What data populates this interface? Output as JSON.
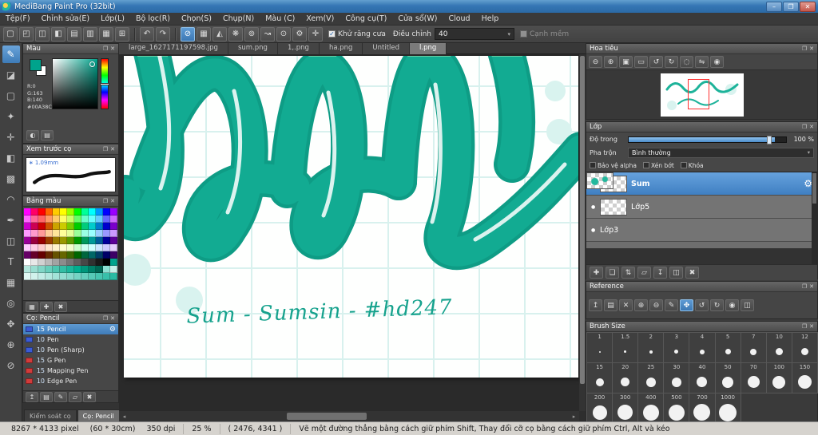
{
  "ui": {
    "accent_blue": "#4a8fd6",
    "current_color": "#00A38C",
    "icons": {
      "float": "❐",
      "close": "✕",
      "gear": "⚙",
      "chevron": "▾",
      "dot": "●",
      "left": "◂",
      "right": "▸",
      "star": "∗"
    }
  },
  "titlebar": {
    "title": "MediBang Paint Pro (32bit)",
    "buttons": [
      {
        "name": "minimize-button",
        "glyph": "–"
      },
      {
        "name": "maximize-button",
        "glyph": "❐"
      },
      {
        "name": "close-button",
        "glyph": "✕"
      }
    ]
  },
  "menubar": {
    "items": [
      "Tệp(F)",
      "Chỉnh sửa(E)",
      "Lớp(L)",
      "Bộ lọc(R)",
      "Chọn(S)",
      "Chụp(N)",
      "Màu (C)",
      "Xem(V)",
      "Công cụ(T)",
      "Cửa sổ(W)",
      "Cloud",
      "Help"
    ]
  },
  "toolbar": {
    "file_icons": [
      {
        "name": "new-canvas-icon",
        "glyph": "▢"
      },
      {
        "name": "open-file-icon",
        "glyph": "◰"
      },
      {
        "name": "save-icon",
        "glyph": "◫"
      },
      {
        "name": "export-icon",
        "glyph": "◧"
      },
      {
        "name": "copy-icon",
        "glyph": "▤"
      },
      {
        "name": "paste-icon",
        "glyph": "▥"
      },
      {
        "name": "material-panel-icon",
        "glyph": "▦"
      },
      {
        "name": "grid-view-icon",
        "glyph": "⊞"
      }
    ],
    "undo_icons": [
      {
        "name": "undo-icon",
        "glyph": "↶"
      },
      {
        "name": "redo-icon",
        "glyph": "↷"
      }
    ],
    "snap_icons": [
      {
        "name": "snap-off-icon",
        "glyph": "⊘",
        "selected": true
      },
      {
        "name": "snap-parallel-icon",
        "glyph": "▦"
      },
      {
        "name": "snap-crisscross-icon",
        "glyph": "◭"
      },
      {
        "name": "snap-vanishing-icon",
        "glyph": "❋"
      },
      {
        "name": "snap-concentric-icon",
        "glyph": "⊚"
      },
      {
        "name": "snap-curve-icon",
        "glyph": "↝"
      },
      {
        "name": "snap-focus-icon",
        "glyph": "⊙"
      },
      {
        "name": "snap-gear-icon",
        "glyph": "⚙"
      },
      {
        "name": "snap-target-icon",
        "glyph": "✛"
      }
    ],
    "antialias_label": "Khử răng cưa",
    "adjust_label": "Điều chỉnh",
    "adjust_value": "40",
    "soft_edge_label": "Cạnh mềm"
  },
  "toolstrip": {
    "tools": [
      {
        "name": "brush-tool",
        "glyph": "✎",
        "selected": true
      },
      {
        "name": "eraser-tool",
        "glyph": "◪"
      },
      {
        "name": "select-tool",
        "glyph": "▢"
      },
      {
        "name": "magic-wand-tool",
        "glyph": "✦"
      },
      {
        "name": "move-tool",
        "glyph": "✛"
      },
      {
        "name": "fill-tool",
        "glyph": "◧"
      },
      {
        "name": "gradient-tool",
        "glyph": "▩"
      },
      {
        "name": "lasso-tool",
        "glyph": "◠"
      },
      {
        "name": "select-pen-tool",
        "glyph": "✒"
      },
      {
        "name": "select-eraser-tool",
        "glyph": "◫"
      },
      {
        "name": "text-tool",
        "glyph": "T"
      },
      {
        "name": "frame-divide-tool",
        "glyph": "▦"
      },
      {
        "name": "eyedropper-tool",
        "glyph": "◎"
      },
      {
        "name": "hand-tool",
        "glyph": "✥"
      },
      {
        "name": "zoom-tool",
        "glyph": "⊕"
      },
      {
        "name": "snap-tool",
        "glyph": "⊘"
      }
    ]
  },
  "color_panel": {
    "title": "Màu",
    "r": "R:0",
    "g": "G:163",
    "b": "B:140",
    "hex": "#00A38C",
    "buttons": [
      {
        "name": "color-wheel-icon",
        "glyph": "◐"
      },
      {
        "name": "color-slider-icon",
        "glyph": "▤"
      }
    ]
  },
  "brush_preview_panel": {
    "title": "Xem trước cọ",
    "size": "1.09mm"
  },
  "palette_panel": {
    "title": "Bảng màu",
    "buttons": [
      {
        "name": "palette-grid-icon",
        "glyph": "▦"
      },
      {
        "name": "palette-add-icon",
        "glyph": "✚"
      },
      {
        "name": "palette-delete-icon",
        "glyph": "✖"
      }
    ],
    "colors": [
      "#FF00FF",
      "#FF0066",
      "#FF0000",
      "#FF6600",
      "#FFCC00",
      "#FFFF00",
      "#99FF00",
      "#00FF00",
      "#00FF99",
      "#00FFFF",
      "#0099FF",
      "#0000FF",
      "#9900FF",
      "#FF66FF",
      "#FF6699",
      "#FF6666",
      "#FF9966",
      "#FFCC66",
      "#FFFF66",
      "#CCFF66",
      "#66FF66",
      "#66FFCC",
      "#66FFFF",
      "#66CCFF",
      "#6666FF",
      "#CC66FF",
      "#CC00CC",
      "#CC0052",
      "#CC0000",
      "#CC5200",
      "#CCA300",
      "#CCCC00",
      "#7ACC00",
      "#00CC00",
      "#00CC7A",
      "#00CCCC",
      "#007ACC",
      "#0000CC",
      "#7A00CC",
      "#FF99FF",
      "#FF99CC",
      "#FF9999",
      "#FFCC99",
      "#FFE599",
      "#FFFF99",
      "#E5FF99",
      "#99FF99",
      "#99FFE5",
      "#99FFFF",
      "#99CCFF",
      "#9999FF",
      "#CC99FF",
      "#990099",
      "#99003D",
      "#990000",
      "#993D00",
      "#997A00",
      "#999900",
      "#5C9900",
      "#009900",
      "#00995C",
      "#009999",
      "#005C99",
      "#000099",
      "#5C0099",
      "#FFCCFF",
      "#FFCCE5",
      "#FFCCCC",
      "#FFE5CC",
      "#FFF2CC",
      "#FFFFCC",
      "#F2FFCC",
      "#CCFFCC",
      "#CCFFF2",
      "#CCFFFF",
      "#CCE5FF",
      "#CCCCFF",
      "#E5CCFF",
      "#660066",
      "#660029",
      "#660000",
      "#662900",
      "#665200",
      "#666600",
      "#3D6600",
      "#006600",
      "#00663D",
      "#006666",
      "#003D66",
      "#000066",
      "#3D0066",
      "#FFFFFF",
      "#E8E8E8",
      "#D1D1D1",
      "#BABABA",
      "#A3A3A3",
      "#8C8C8C",
      "#757575",
      "#5E5E5E",
      "#474747",
      "#303030",
      "#191919",
      "#000000",
      "#00A38C",
      "#B3E6DC",
      "#99DED1",
      "#80D6C6",
      "#66CEBB",
      "#4DC6B0",
      "#33BEA5",
      "#1AB69A",
      "#00AE8F",
      "#00967B",
      "#007E67",
      "#006653",
      "#8CE0D2",
      "#C6F0E9",
      "#E0F7F3",
      "#D1F2EC",
      "#C2EDE6",
      "#B3E8DF",
      "#A3E3D8",
      "#94DED2",
      "#85D9CB",
      "#75D4C4",
      "#66CFBE",
      "#57CAB7",
      "#47C5B0",
      "#38C0AA",
      "#29BBA3"
    ]
  },
  "brush_list_panel": {
    "title": "Cọ: Pencil",
    "brushes": [
      {
        "size": "15",
        "name": "Pencil",
        "selected": true,
        "tag": "#3b5bd6"
      },
      {
        "size": "10",
        "name": "Pen",
        "tag": "#3b5bd6"
      },
      {
        "size": "10",
        "name": "Pen (Sharp)",
        "tag": "#3b5bd6"
      },
      {
        "size": "15",
        "name": "G Pen",
        "tag": "#d23b3b"
      },
      {
        "size": "15",
        "name": "Mapping Pen",
        "tag": "#d23b3b"
      },
      {
        "size": "10",
        "name": "Edge Pen",
        "tag": "#d23b3b"
      }
    ],
    "buttons": [
      {
        "name": "brush-upload-icon",
        "glyph": "↥"
      },
      {
        "name": "brush-menu-icon",
        "glyph": "▤"
      },
      {
        "name": "brush-add-icon",
        "gly_x": "",
        "glyph": "✎"
      },
      {
        "name": "brush-folder-icon",
        "glyph": "▱"
      },
      {
        "name": "brush-delete-icon",
        "glyph": "✖"
      }
    ]
  },
  "dock_tabs": [
    {
      "label": "Kiểm soát cọ"
    },
    {
      "label": "Cọ: Pencil",
      "active": true
    }
  ],
  "canvas": {
    "tabs": [
      {
        "label": "large_1627171197598.jpg"
      },
      {
        "label": "sum.png"
      },
      {
        "label": "1,.png"
      },
      {
        "label": "ha.png"
      },
      {
        "label": "Untitled"
      },
      {
        "label": "l.png",
        "active": true
      }
    ],
    "caption": "Sum - Sumsin - #hd247"
  },
  "navigator_panel": {
    "title": "Hoa tiêu",
    "buttons": [
      {
        "name": "nav-zoom-out-icon",
        "glyph": "⊖"
      },
      {
        "name": "nav-zoom-in-icon",
        "glyph": "⊕"
      },
      {
        "name": "nav-fit-icon",
        "glyph": "▣"
      },
      {
        "name": "nav-actual-size-icon",
        "glyph": "▭"
      },
      {
        "name": "nav-rotate-left-icon",
        "glyph": "↺"
      },
      {
        "name": "nav-rotate-right-icon",
        "glyph": "↻"
      },
      {
        "name": "nav-reset-rotation-icon",
        "glyph": "◌"
      },
      {
        "name": "nav-flip-icon",
        "glyph": "⇋"
      },
      {
        "name": "nav-refresh-icon",
        "glyph": "◉"
      }
    ]
  },
  "layers_panel": {
    "title": "Lớp",
    "opacity_label": "Độ trong",
    "opacity_value": "100 %",
    "blend_label": "Pha trộn",
    "blend_mode": "Bình thường",
    "options": [
      "Bảo vệ alpha",
      "Xén bớt",
      "Khóa"
    ],
    "layers": [
      {
        "name": "Sum",
        "selected": true
      },
      {
        "name": "Lớp5"
      },
      {
        "name": "Lớp3",
        "art": true
      }
    ],
    "buttons": [
      {
        "name": "add-layer-button",
        "glyph": "✚"
      },
      {
        "name": "duplicate-layer-button",
        "glyph": "❏"
      },
      {
        "name": "move-layer-button",
        "glyph": "⇅"
      },
      {
        "name": "layer-folder-button",
        "glyph": "▱"
      },
      {
        "name": "merge-layer-button",
        "glyph": "↧"
      },
      {
        "name": "clear-layer-button",
        "glyph": "◫"
      },
      {
        "name": "delete-layer-button",
        "glyph": "✖"
      }
    ]
  },
  "reference_panel": {
    "title": "Reference",
    "buttons": [
      {
        "name": "ref-import-icon",
        "glyph": "↥"
      },
      {
        "name": "ref-open-icon",
        "glyph": "▤"
      },
      {
        "name": "ref-clear-icon",
        "glyph": "✕"
      },
      {
        "name": "ref-zoom-in-icon",
        "glyph": "⊕"
      },
      {
        "name": "ref-zoom-out-icon",
        "glyph": "⊖"
      },
      {
        "name": "ref-eyedropper-icon",
        "glyph": "✎"
      },
      {
        "name": "ref-hand-icon",
        "glyph": "✥",
        "selected": true
      },
      {
        "name": "ref-rotate-left-icon",
        "glyph": "↺"
      },
      {
        "name": "ref-rotate-right-icon",
        "glyph": "↻"
      },
      {
        "name": "ref-reset-icon",
        "glyph": "◉"
      },
      {
        "name": "ref-flip-icon",
        "glyph": "◫"
      }
    ]
  },
  "brush_size_panel": {
    "title": "Brush Size",
    "sizes": [
      "1",
      "1.5",
      "2",
      "3",
      "4",
      "5",
      "7",
      "10",
      "12",
      "15",
      "20",
      "25",
      "30",
      "40",
      "50",
      "70",
      "100",
      "150",
      "200",
      "300",
      "400",
      "500",
      "700",
      "1000"
    ]
  },
  "statusbar": {
    "pixel_size": "8267 * 4133 pixel",
    "cm_size": "(60 * 30cm)",
    "dpi": "350 dpi",
    "zoom": "25 %",
    "cursor": "( 2476, 4341 )",
    "hint": "Vẽ một đường thẳng bằng cách giữ phím Shift, Thay đổi cỡ cọ bằng cách giữ phím Ctrl, Alt và kéo"
  }
}
